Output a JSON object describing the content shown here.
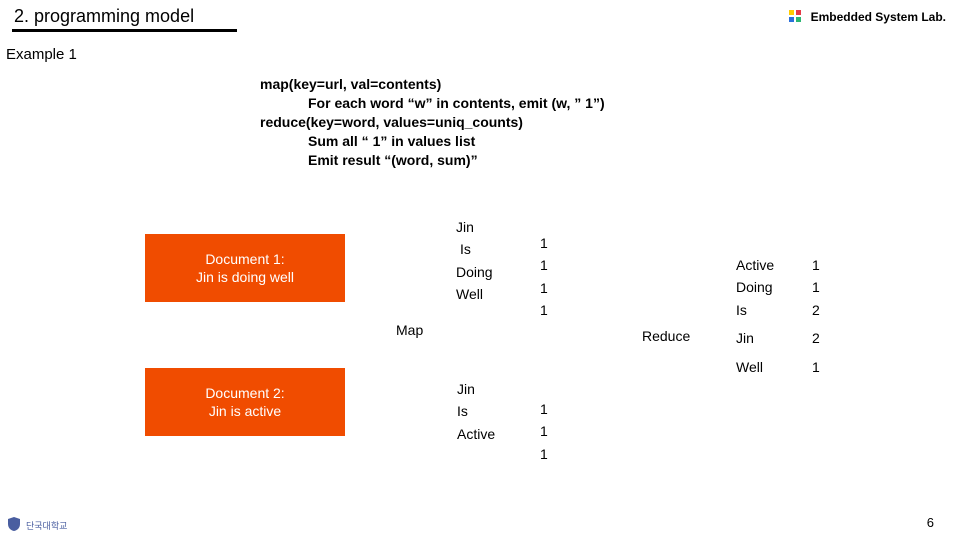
{
  "header": {
    "title": "2. programming model",
    "lab": "Embedded System Lab."
  },
  "subtitle": "Example 1",
  "pseudo": {
    "l1": "map(key=url, val=contents)",
    "l2": "For each word “w” in contents, emit (w, ” 1”)",
    "l3": "reduce(key=word, values=uniq_counts)",
    "l4": "Sum all “ 1” in values list",
    "l5": "Emit result “(word, sum)”"
  },
  "docs": {
    "d1_title": "Document 1:",
    "d1_body": "Jin is doing well",
    "d2_title": "Document 2:",
    "d2_body": "Jin is active"
  },
  "labels": {
    "map": "Map",
    "reduce": "Reduce"
  },
  "emit1": {
    "w0": "Jin",
    "w1": "Is",
    "w2": "Doing",
    "w3": "Well",
    "n0": "1",
    "n1": "1",
    "n2": "1",
    "n3": "1"
  },
  "emit2": {
    "w0": "Jin",
    "w1": "Is",
    "w2": "Active",
    "n0": "1",
    "n1": "1",
    "n2": "1"
  },
  "out": {
    "w0": "Active",
    "w1": "Doing",
    "w2": "Is",
    "w3": "Jin",
    "w4": "Well",
    "n0": "1",
    "n1": "1",
    "n2": "2",
    "n3": "2",
    "n4": "1"
  },
  "page": "6",
  "footer": "단국대학교"
}
